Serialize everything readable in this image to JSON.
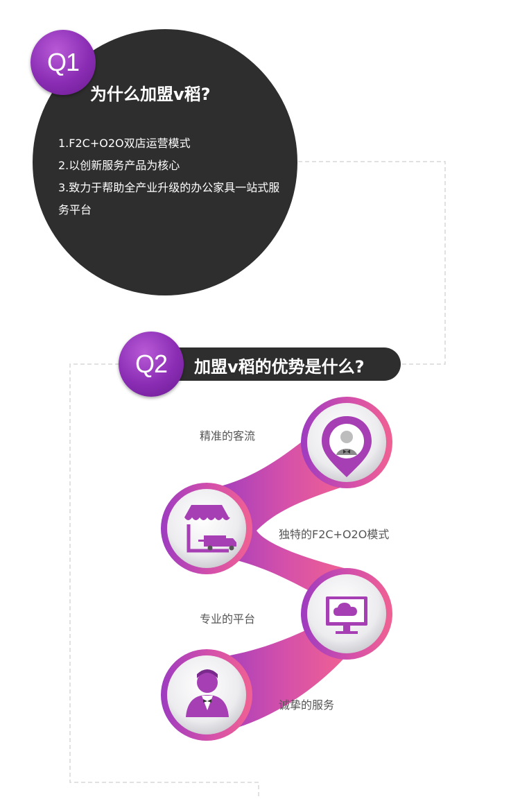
{
  "q1": {
    "badge": "Q1",
    "title": "为什么加盟v稻?",
    "items": [
      "1.F2C+O2O双店运营模式",
      "2.以创新服务产品为核心",
      "3.致力于帮助全产业升级的办公家具一站式服务平台"
    ]
  },
  "q2": {
    "badge": "Q2",
    "title": "加盟v稻的优势是什么?"
  },
  "features": [
    {
      "label": "精准的客流",
      "icon": "location-person-icon"
    },
    {
      "label": "独特的F2C+O2O模式",
      "icon": "storefront-truck-icon"
    },
    {
      "label": "专业的平台",
      "icon": "monitor-cloud-icon"
    },
    {
      "label": "诚挚的服务",
      "icon": "waiter-icon"
    }
  ],
  "colors": {
    "dark": "#2e2e2e",
    "purple": "#8a2db4",
    "pink": "#ee5f97"
  }
}
